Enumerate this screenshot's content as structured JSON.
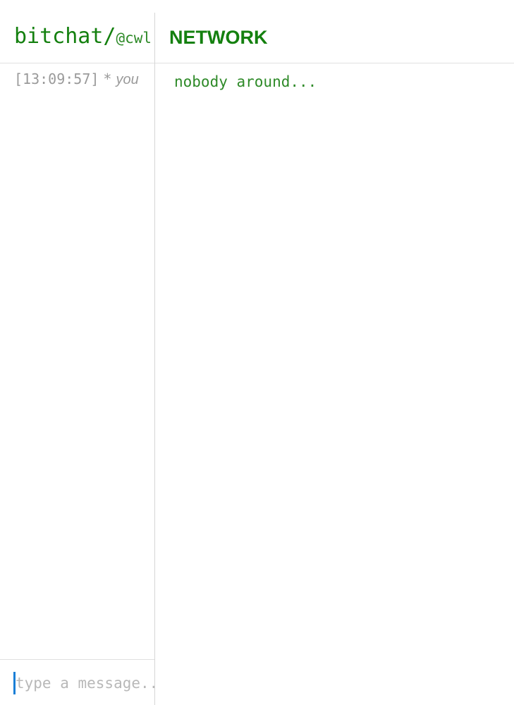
{
  "header": {
    "app_name": "bitchat/",
    "nickname": "@cwl"
  },
  "messages": [
    {
      "timestamp": "[13:09:57]",
      "marker": "*",
      "text": "you"
    }
  ],
  "composer": {
    "placeholder": "type a message..."
  },
  "network": {
    "title": "NETWORK",
    "empty_text": "nobody around..."
  },
  "colors": {
    "accent_green": "#14800f",
    "muted_text": "#9a9a9a",
    "caret_blue": "#1a7fd6"
  }
}
